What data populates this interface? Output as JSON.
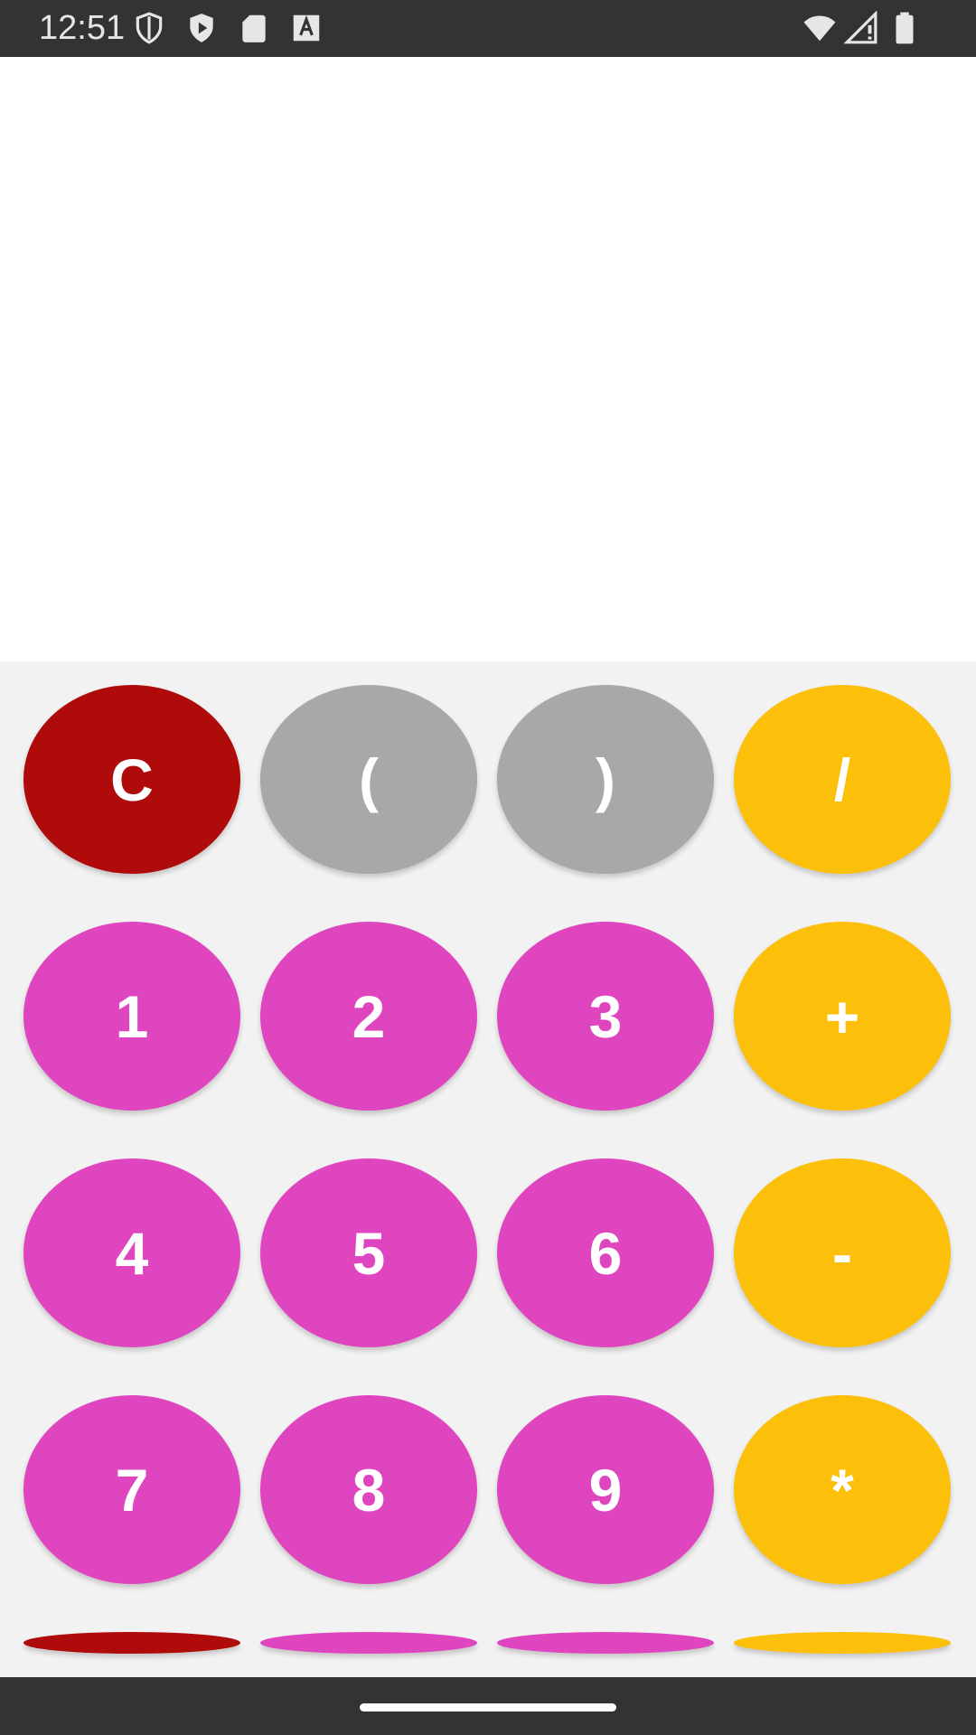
{
  "status_bar": {
    "time": "12:51",
    "left_icons": [
      "shield-outline-icon",
      "play-protect-icon",
      "sd-card-icon",
      "keyboard-a-icon"
    ],
    "right_icons": [
      "wifi-icon",
      "cell-signal-icon",
      "battery-icon"
    ]
  },
  "display": {
    "expression": ""
  },
  "keypad": {
    "rows": [
      [
        {
          "label": "C",
          "kind": "clear"
        },
        {
          "label": "(",
          "kind": "paren"
        },
        {
          "label": ")",
          "kind": "paren"
        },
        {
          "label": "/",
          "kind": "op"
        }
      ],
      [
        {
          "label": "1",
          "kind": "num"
        },
        {
          "label": "2",
          "kind": "num"
        },
        {
          "label": "3",
          "kind": "num"
        },
        {
          "label": "+",
          "kind": "op"
        }
      ],
      [
        {
          "label": "4",
          "kind": "num"
        },
        {
          "label": "5",
          "kind": "num"
        },
        {
          "label": "6",
          "kind": "num"
        },
        {
          "label": "-",
          "kind": "op"
        }
      ],
      [
        {
          "label": "7",
          "kind": "num"
        },
        {
          "label": "8",
          "kind": "num"
        },
        {
          "label": "9",
          "kind": "num"
        },
        {
          "label": "*",
          "kind": "op"
        }
      ]
    ],
    "colors": {
      "clear": "#b00b0b",
      "paren": "#a8a8a8",
      "op": "#fcc00a",
      "num": "#e045c0"
    }
  },
  "nav_bar": {
    "icons": [
      "home-pill-icon"
    ]
  }
}
